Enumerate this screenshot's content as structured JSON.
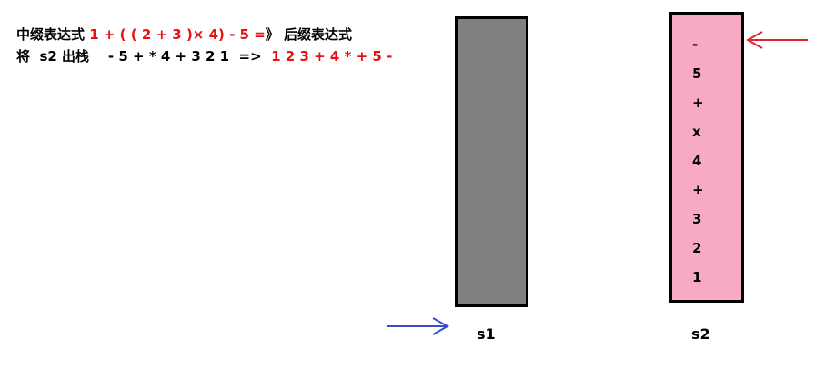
{
  "line1": {
    "prefix": "中缀表达式 ",
    "infix_expression": "1 + ( ( 2 + 3 )× 4) - 5 =",
    "arrow_symbol": "》",
    "suffix": " 后缀表达式"
  },
  "line2": {
    "prefix": "将  s2 出栈    ",
    "popped_sequence": "- 5 + * 4 + 3 2 1  =>  ",
    "postfix_expression": "1 2 3 + 4 * + 5 -"
  },
  "stacks": {
    "s1": {
      "label": "s1",
      "fill_color": "#808080",
      "items": []
    },
    "s2": {
      "label": "s2",
      "fill_color": "#f8aac5",
      "items": [
        "-",
        "5",
        "+",
        "x",
        "4",
        "+",
        "3",
        "2",
        "1"
      ]
    }
  },
  "arrows": {
    "s1_pointer": {
      "color": "#3a4cc4",
      "direction": "right",
      "icon": "arrow-right-icon"
    },
    "s2_pointer": {
      "color": "#e0252e",
      "direction": "left",
      "icon": "arrow-left-icon"
    }
  }
}
